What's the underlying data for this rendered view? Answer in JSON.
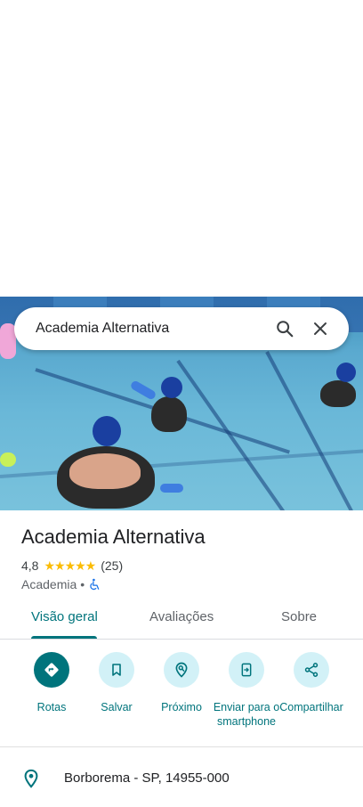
{
  "search": {
    "query": "Academia Alternativa"
  },
  "place": {
    "title": "Academia Alternativa",
    "rating": "4,8",
    "stars": "★★★★★",
    "review_count": "(25)",
    "category": "Academia",
    "separator": "•"
  },
  "tabs": [
    {
      "label": "Visão geral"
    },
    {
      "label": "Avaliações"
    },
    {
      "label": "Sobre"
    }
  ],
  "actions": [
    {
      "label": "Rotas"
    },
    {
      "label": "Salvar"
    },
    {
      "label": "Próximo"
    },
    {
      "label": "Enviar para o smartphone"
    },
    {
      "label": "Compartilhar"
    }
  ],
  "address": "Borborema - SP, 14955-000",
  "colors": {
    "accent": "#00747c",
    "action_bg": "#d2f1f7",
    "star": "#fbbc04"
  },
  "icons": [
    "search-icon",
    "close-icon",
    "accessibility-icon",
    "directions-icon",
    "bookmark-icon",
    "nearby-icon",
    "send-to-phone-icon",
    "share-icon",
    "location-pin-icon"
  ]
}
